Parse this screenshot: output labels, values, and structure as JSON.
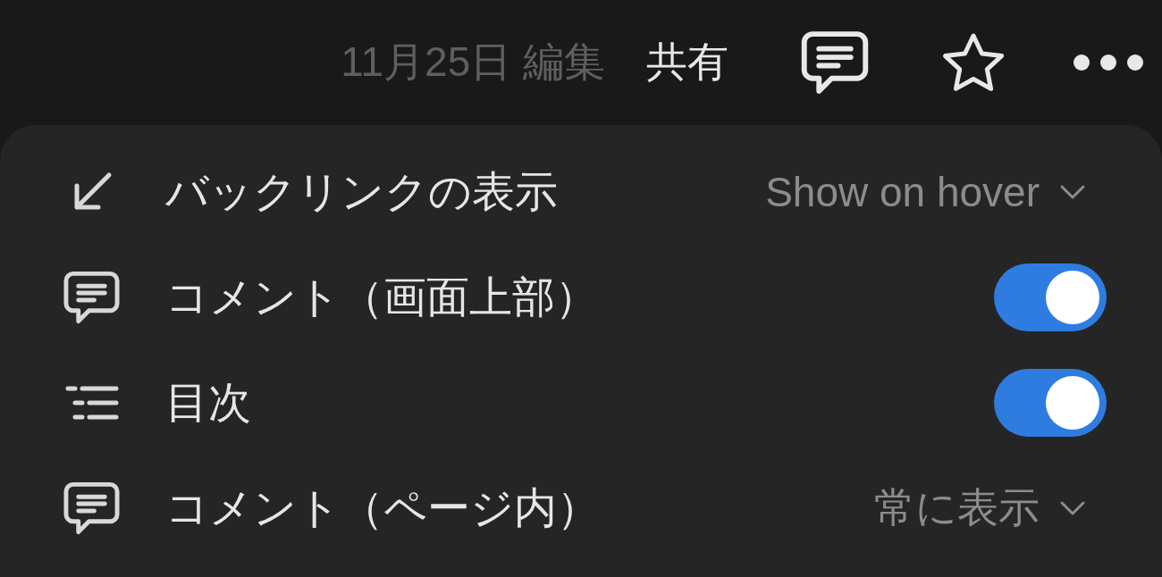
{
  "header": {
    "edited": "11月25日 編集",
    "share": "共有"
  },
  "menu": {
    "items": [
      {
        "kind": "select",
        "label": "バックリンクの表示",
        "value": "Show on hover"
      },
      {
        "kind": "toggle",
        "label": "コメント（画面上部）",
        "on": true
      },
      {
        "kind": "toggle",
        "label": "目次",
        "on": true
      },
      {
        "kind": "select",
        "label": "コメント（ページ内）",
        "value": "常に表示"
      }
    ]
  }
}
